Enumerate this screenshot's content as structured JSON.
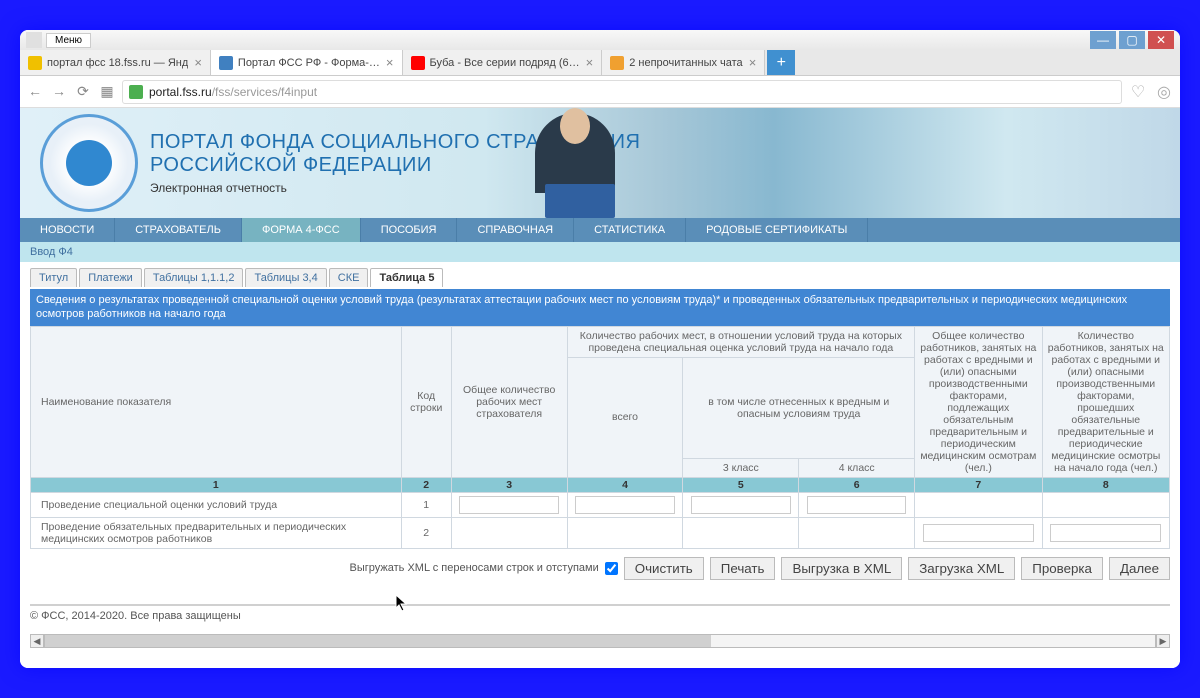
{
  "browser": {
    "menu": "Меню",
    "tabs": [
      {
        "title": "портал фсс 18.fss.ru — Янд",
        "active": false,
        "favicon": "ya"
      },
      {
        "title": "Портал ФСС РФ - Форма-…",
        "active": true,
        "favicon": "fss"
      },
      {
        "title": "Буба - Все серии подряд (6…",
        "active": false,
        "favicon": "yt"
      },
      {
        "title": "2 непрочитанных чата",
        "active": false,
        "favicon": "mail"
      }
    ],
    "url_domain": "portal.fss.ru",
    "url_path": "/fss/services/f4input"
  },
  "portal": {
    "title_line1": "ПОРТАЛ ФОНДА СОЦИАЛЬНОГО СТРАХОВАНИЯ",
    "title_line2": "РОССИЙСКОЙ ФЕДЕРАЦИИ",
    "subtitle": "Электронная отчетность"
  },
  "main_nav": [
    "НОВОСТИ",
    "СТРАХОВАТЕЛЬ",
    "ФОРМА 4-ФСС",
    "ПОСОБИЯ",
    "СПРАВОЧНАЯ",
    "СТАТИСТИКА",
    "РОДОВЫЕ СЕРТИФИКАТЫ"
  ],
  "main_nav_active": 2,
  "sub_link": "Ввод Ф4",
  "inner_tabs": [
    "Титул",
    "Платежи",
    "Таблицы 1,1.1,2",
    "Таблицы 3,4",
    "СКЕ",
    "Таблица 5"
  ],
  "inner_tab_active": 5,
  "notice": "Сведения о результатах проведенной специальной оценки условий труда (результатах аттестации рабочих мест по условиям труда)* и проведенных обязательных предварительных и периодических медицинских осмотров работников на начало года",
  "table": {
    "head": {
      "c1": "Наименование показателя",
      "c2": "Код строки",
      "c3": "Общее количество рабочих мест страхователя",
      "c4_top": "Количество рабочих мест, в отношении условий труда на которых проведена специальная оценка условий труда на начало года",
      "c4_all": "всего",
      "c4_sub": "в том числе отнесенных к вредным и опасным условиям труда",
      "c4_k3": "3 класс",
      "c4_k4": "4 класс",
      "c5": "Общее количество работников, занятых на работах с вредными и (или) опасными производственными факторами, подлежащих обязательным предварительным и периодическим медицинским осмотрам (чел.)",
      "c6": "Количество работников, занятых на работах с вредными и (или) опасными производственными факторами, прошедших обязательные предварительные и периодические медицинские осмотры на начало года (чел.)"
    },
    "numrow": [
      "1",
      "2",
      "3",
      "4",
      "5",
      "6",
      "7",
      "8"
    ],
    "rows": [
      {
        "name": "Проведение специальной оценки условий труда",
        "code": "1",
        "inputs": [
          true,
          true,
          true,
          true,
          false,
          false
        ]
      },
      {
        "name": "Проведение обязательных предварительных и периодических медицинских осмотров работников",
        "code": "2",
        "inputs": [
          false,
          false,
          false,
          false,
          true,
          true
        ]
      }
    ]
  },
  "actions": {
    "xml_label": "Выгружать XML с переносами строк и отступами",
    "buttons": [
      "Очистить",
      "Печать",
      "Выгрузка в XML",
      "Загрузка XML",
      "Проверка",
      "Далее"
    ]
  },
  "footer": "© ФСС, 2014-2020. Все права защищены"
}
